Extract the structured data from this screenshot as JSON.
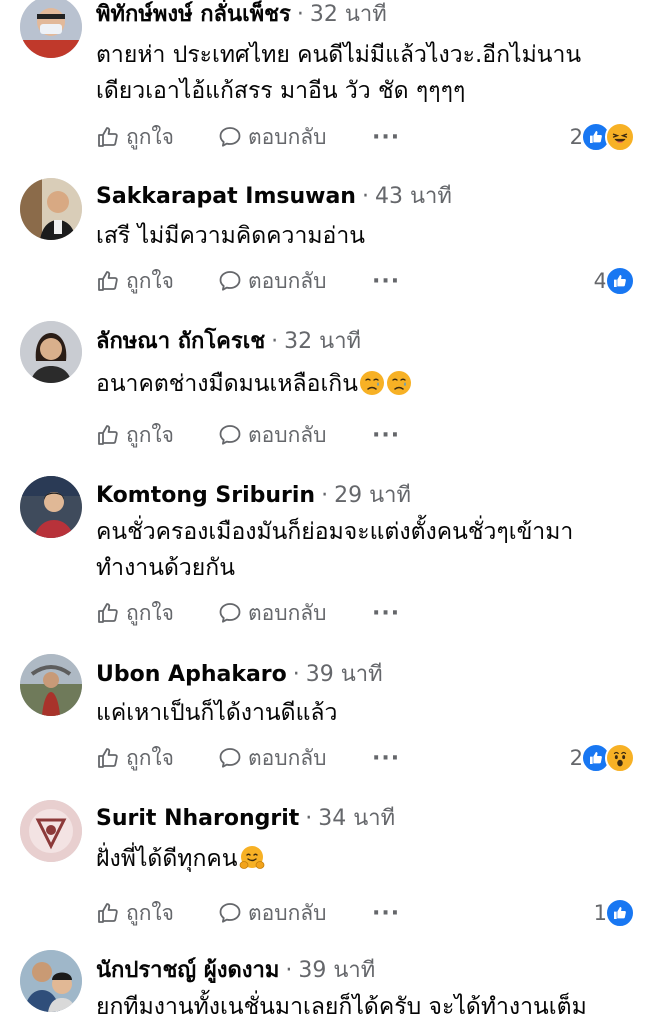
{
  "labels": {
    "like": "ถูกใจ",
    "reply": "ตอบกลับ",
    "more": "···",
    "dot": "·"
  },
  "colors": {
    "like_blue": "#1877f2",
    "secondary_text": "#65676b",
    "emoji_yellow": "#f7b125"
  },
  "comments": [
    {
      "author": "พิทักษ์พงษ์ กลั่นเพ็ชร",
      "time": "32 นาที",
      "lines": [
        "ตายห่า ประเทศไทย คนดีไม่มีแล้วไงวะ.อีกไม่นาน",
        "เดียวเอาไอ้แก้สรร มาอีน วัว ชัด ๆๆๆๆ"
      ],
      "reaction_count": "2",
      "reactions": [
        "like-icon",
        "haha-icon"
      ]
    },
    {
      "author": "Sakkarapat Imsuwan",
      "time": "43 นาที",
      "lines": [
        "เสรี ไม่มีความคิดความอ่าน"
      ],
      "reaction_count": "4",
      "reactions": [
        "like-icon"
      ]
    },
    {
      "author": "ลักษณา ถักโครเช",
      "time": "32 นาที",
      "lines": [
        "อนาคตช่างมืดมนเหลือเกิน"
      ],
      "inline_emojis": [
        "crying-face-icon",
        "crying-face-icon"
      ],
      "reaction_count": "",
      "reactions": []
    },
    {
      "author": "Komtong Sriburin",
      "time": "29 นาที",
      "lines": [
        "คนชั่วครองเมืองมันก็ย่อมจะแต่งตั้งคนชั่วๆเข้ามา",
        "ทำงานด้วยกัน"
      ],
      "reaction_count": "",
      "reactions": []
    },
    {
      "author": "Ubon Aphakaro",
      "time": "39 นาที",
      "lines": [
        "แค่เหาเป็นก็ได้งานดีแล้ว"
      ],
      "reaction_count": "2",
      "reactions": [
        "like-icon",
        "wow-icon"
      ]
    },
    {
      "author": "Surit Nharongrit",
      "time": "34 นาที",
      "lines": [
        "ฝั่งพี่ได้ดีทุกคน"
      ],
      "inline_emojis": [
        "hugging-face-icon"
      ],
      "reaction_count": "1",
      "reactions": [
        "like-icon"
      ]
    },
    {
      "author": "นักปราชญ์ ผู้งดงาม",
      "time": "39 นาที",
      "lines": [
        "ยกทีมงานทั้งเนชั่นมาเลยก็ได้ครับ จะได้ทำงานเต็ม"
      ],
      "reaction_count": "",
      "reactions": []
    }
  ]
}
